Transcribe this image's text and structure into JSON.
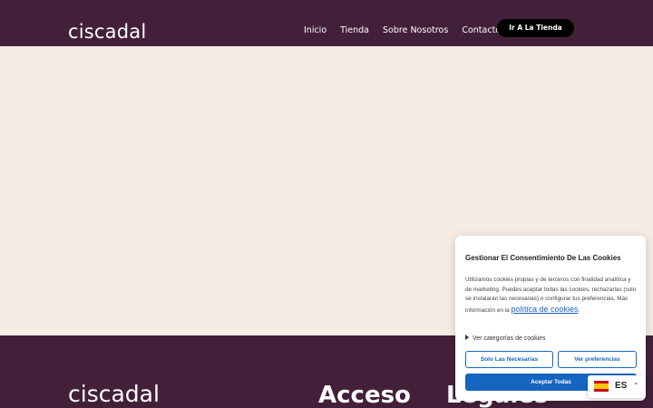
{
  "header": {
    "logo": "ciscadal",
    "nav": [
      {
        "label": "Inicio"
      },
      {
        "label": "Tienda"
      },
      {
        "label": "Sobre Nosotros"
      },
      {
        "label": "Contacto"
      }
    ],
    "cta_label": "Ir A La Tienda"
  },
  "footer": {
    "logo": "ciscadal",
    "heading": "Acceso Legales"
  },
  "cookie_banner": {
    "title": "Gestionar El Consentimiento De Las Cookies",
    "body": "Utilizamos cookies propias y de terceros con finalidad analítica y de marketing. Puedes aceptar todas las cookies, rechazarlas (solo se instalarán las necesarias) o configurar tus preferencias. Más información en la",
    "link": "política de cookies",
    "link_suffix": ".",
    "categories_label": "Ver categorías de cookies",
    "only_necessary_label": "Solo Las Necesarias",
    "preferences_label": "Ver preferencias",
    "accept_all_label": "Aceptar Todas"
  },
  "language": {
    "code": "ES",
    "flag_icon": "spain-flag-icon",
    "chevron_icon": "chevron-up-icon"
  },
  "colors": {
    "header_bg": "#43203a",
    "page_bg": "#f6ece4",
    "accent_blue": "#1665c0",
    "cta_bg": "#000000"
  }
}
